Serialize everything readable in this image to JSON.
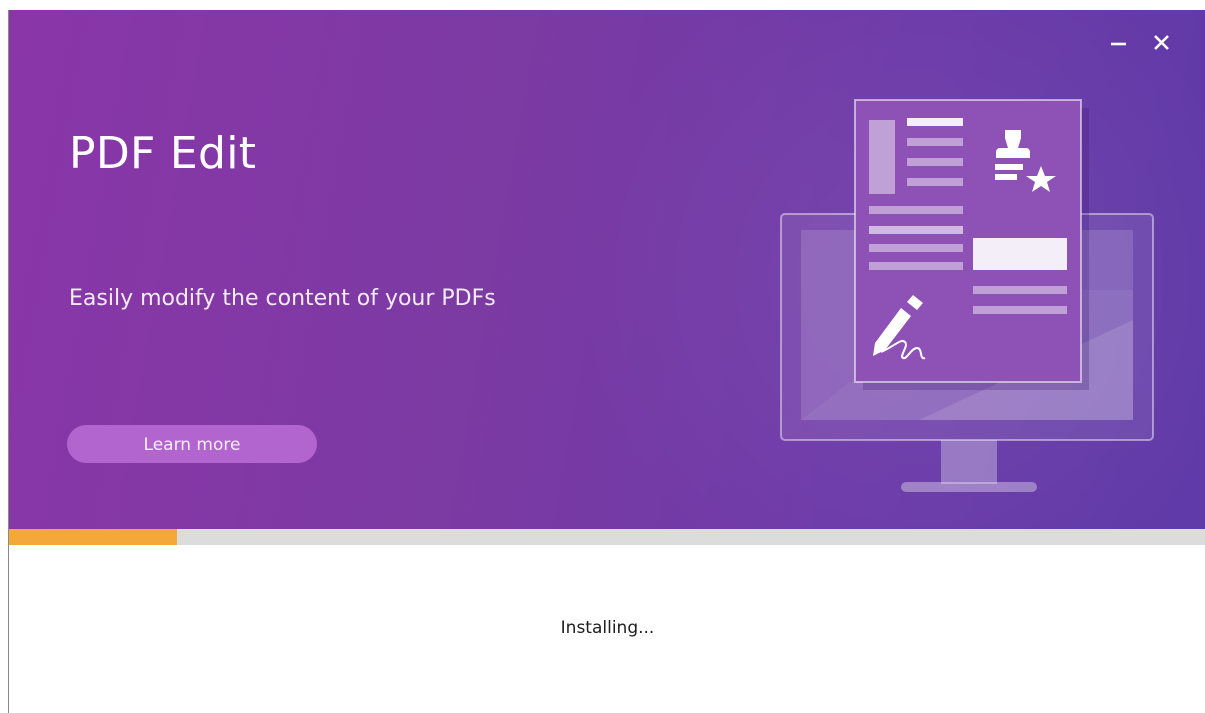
{
  "window": {
    "minimize_label": "–",
    "close_label": "×"
  },
  "banner": {
    "title": "PDF Edit",
    "subtitle": "Easily modify the content of your PDFs",
    "learn_more_label": "Learn more",
    "background_color": "#7c3aa3",
    "button_color": "#b264cf",
    "illustration_icons": [
      "monitor-icon",
      "document-icon",
      "stamp-star-icon",
      "pen-signature-icon"
    ]
  },
  "install": {
    "progress": 0.14,
    "progress_color": "#f5a83a",
    "track_color": "#dcdcdc",
    "status_text": "Installing..."
  }
}
